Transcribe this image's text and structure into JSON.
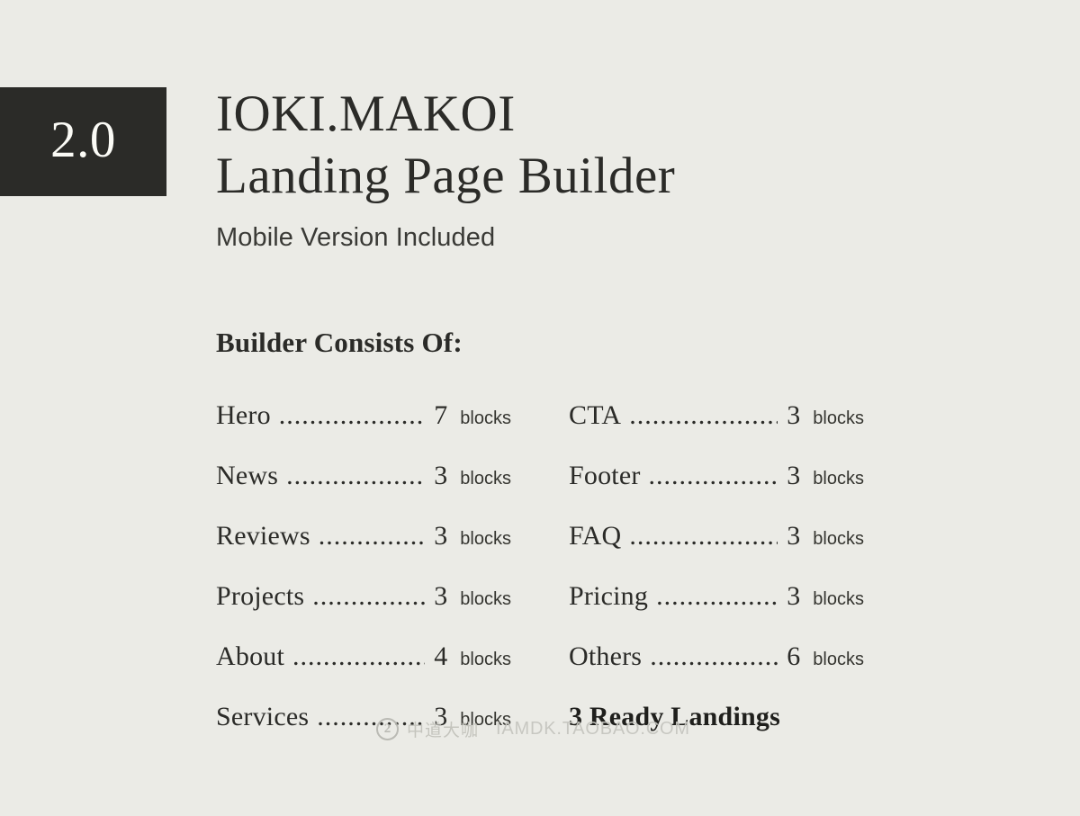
{
  "background_color": "#ebebe6",
  "accent_color": "#2b2b28",
  "badge": {
    "version": "2.0"
  },
  "header": {
    "brand": "IOKI.MAKOI",
    "product": "Landing Page Builder",
    "subtitle": "Mobile Version Included"
  },
  "section": {
    "heading": "Builder Consists Of:",
    "unit_label": "blocks",
    "leader": "..............................................",
    "left_column": [
      {
        "label": "Hero",
        "count": "7",
        "unit": "blocks"
      },
      {
        "label": "News",
        "count": "3",
        "unit": "blocks"
      },
      {
        "label": "Reviews",
        "count": "3",
        "unit": "blocks"
      },
      {
        "label": "Projects",
        "count": "3",
        "unit": "blocks"
      },
      {
        "label": "About",
        "count": "4",
        "unit": "blocks"
      },
      {
        "label": "Services",
        "count": "3",
        "unit": "blocks"
      }
    ],
    "right_column": [
      {
        "label": "CTA",
        "count": "3",
        "unit": "blocks"
      },
      {
        "label": "Footer",
        "count": "3",
        "unit": "blocks"
      },
      {
        "label": "FAQ",
        "count": "3",
        "unit": "blocks"
      },
      {
        "label": "Pricing",
        "count": "3",
        "unit": "blocks"
      },
      {
        "label": "Others",
        "count": "6",
        "unit": "blocks"
      }
    ],
    "footer_note": "3 Ready Landings"
  },
  "watermark": {
    "logo_glyph": "2",
    "chinese_text": "中道大咖",
    "url": "IAMDK.TAOBAO.COM"
  }
}
